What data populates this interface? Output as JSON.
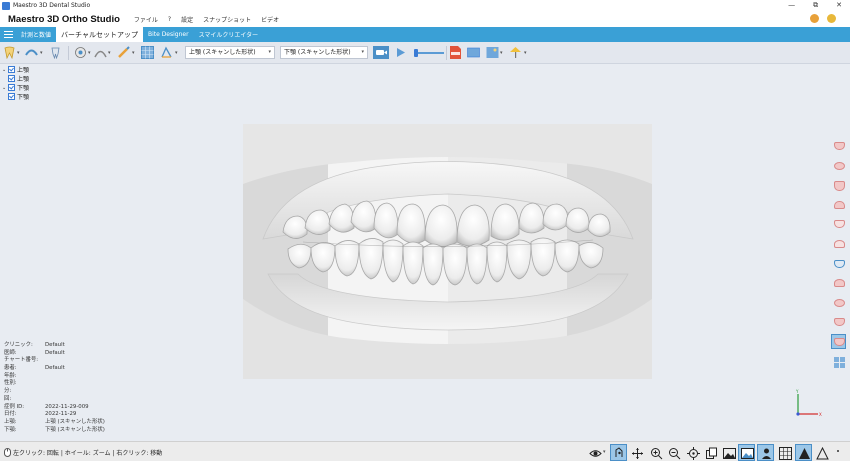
{
  "window": {
    "title": "Maestro 3D Dental Studio",
    "buttons": [
      "—",
      "⧉",
      "✕"
    ]
  },
  "menubar": {
    "brand": "Maestro 3D Ortho Studio",
    "items": [
      "ファイル",
      "?",
      "設定",
      "スナップショット",
      "ビデオ"
    ]
  },
  "tabs": [
    {
      "label": "計測と数値",
      "active": false
    },
    {
      "label": "バーチャルセットアップ",
      "active": true
    },
    {
      "label": "Bite Designer",
      "active": false
    },
    {
      "label": "スマイルクリエイター",
      "active": false
    }
  ],
  "toolbar": {
    "upper_select": "上顎 (スキャンした形状)",
    "lower_select": "下顎 (スキャンした形状)"
  },
  "tree": [
    {
      "toggle": "⌄",
      "label": "上顎",
      "level": 0
    },
    {
      "toggle": "",
      "label": "上顎",
      "level": 1
    },
    {
      "toggle": "⌄",
      "label": "下顎",
      "level": 0
    },
    {
      "toggle": "",
      "label": "下顎",
      "level": 1
    }
  ],
  "info": [
    {
      "key": "クリニック:",
      "value": "Default"
    },
    {
      "key": "医師:",
      "value": "Default"
    },
    {
      "key": "チャート番号:",
      "value": ""
    },
    {
      "key": "患者:",
      "value": "Default"
    },
    {
      "key": "年齢:",
      "value": ""
    },
    {
      "key": "性別:",
      "value": ""
    },
    {
      "key": "分:",
      "value": ""
    },
    {
      "key": "回:",
      "value": ""
    },
    {
      "key": "症例 ID:",
      "value": "2022-11-29-009"
    },
    {
      "key": "日付:",
      "value": "2022-11-29"
    },
    {
      "key": "上顎:",
      "value": "上顎 (スキャンした形状)"
    },
    {
      "key": "下顎:",
      "value": "下顎 (スキャンした形状)"
    }
  ],
  "status": {
    "hint": "左クリック: 回転 | ホイール: ズーム | 右クリック: 移動"
  },
  "axis": {
    "y": "Y",
    "x": "X"
  },
  "colors": {
    "accent": "#3aa0d6",
    "selected": "#9cc7e8"
  }
}
